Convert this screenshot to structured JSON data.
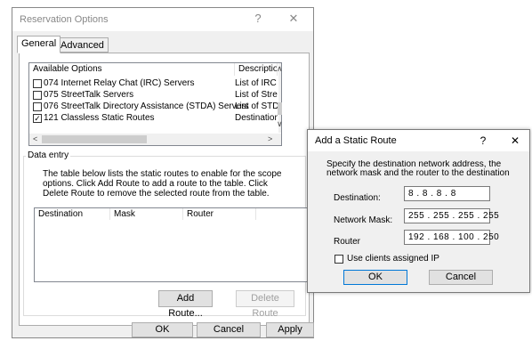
{
  "reservation_dialog": {
    "title": "Reservation Options",
    "help_glyph": "?",
    "close_glyph": "✕",
    "tabs": [
      {
        "label": "General",
        "active": true
      },
      {
        "label": "Advanced",
        "active": false
      }
    ],
    "options_list": {
      "columns": [
        "Available Options",
        "Description"
      ],
      "scroll_up_glyph": "∧",
      "scroll_down_glyph": "∨",
      "scroll_left_glyph": "<",
      "scroll_right_glyph": ">",
      "rows": [
        {
          "label": "074 Internet Relay Chat (IRC) Servers",
          "description": "List of IRC s",
          "checked": false
        },
        {
          "label": "075 StreetTalk Servers",
          "description": "List of Stree",
          "checked": false
        },
        {
          "label": "076 StreetTalk Directory Assistance (STDA) Servers",
          "description": "List of STDA",
          "checked": false
        },
        {
          "label": "121 Classless Static Routes",
          "description": "Destination, ",
          "checked": true
        }
      ],
      "checkmark_glyph": "✓"
    },
    "data_entry": {
      "group_label": "Data entry",
      "description": [
        "The table below lists the static routes to enable for the scope",
        "options.  Click Add Route to add a route to the table.  Click",
        "Delete Route to remove the selected route from the table."
      ],
      "table_columns": [
        "Destination",
        "Mask",
        "Router"
      ],
      "add_route_label": "Add Route...",
      "delete_route_label": "Delete Route"
    },
    "buttons": {
      "ok": "OK",
      "cancel": "Cancel",
      "apply": "Apply"
    }
  },
  "route_dialog": {
    "title": "Add a Static Route",
    "help_glyph": "?",
    "close_glyph": "✕",
    "instructions": [
      "Specify the destination network address, the",
      "network mask and the router to the destination"
    ],
    "fields": {
      "destination": {
        "label": "Destination:",
        "value": "8  .  8  .  8  .  8"
      },
      "network_mask": {
        "label": "Network Mask:",
        "value": "255 . 255 . 255 . 255"
      },
      "router": {
        "label": "Router",
        "value": "192 . 168 . 100 . 250"
      }
    },
    "use_clients_label": "Use clients assigned IP",
    "use_clients_checked": false,
    "buttons": {
      "ok": "OK",
      "cancel": "Cancel"
    }
  },
  "colors": {
    "accent": "#0078d7",
    "dialog_bg": "#f0f0f0",
    "border": "#adadad"
  }
}
